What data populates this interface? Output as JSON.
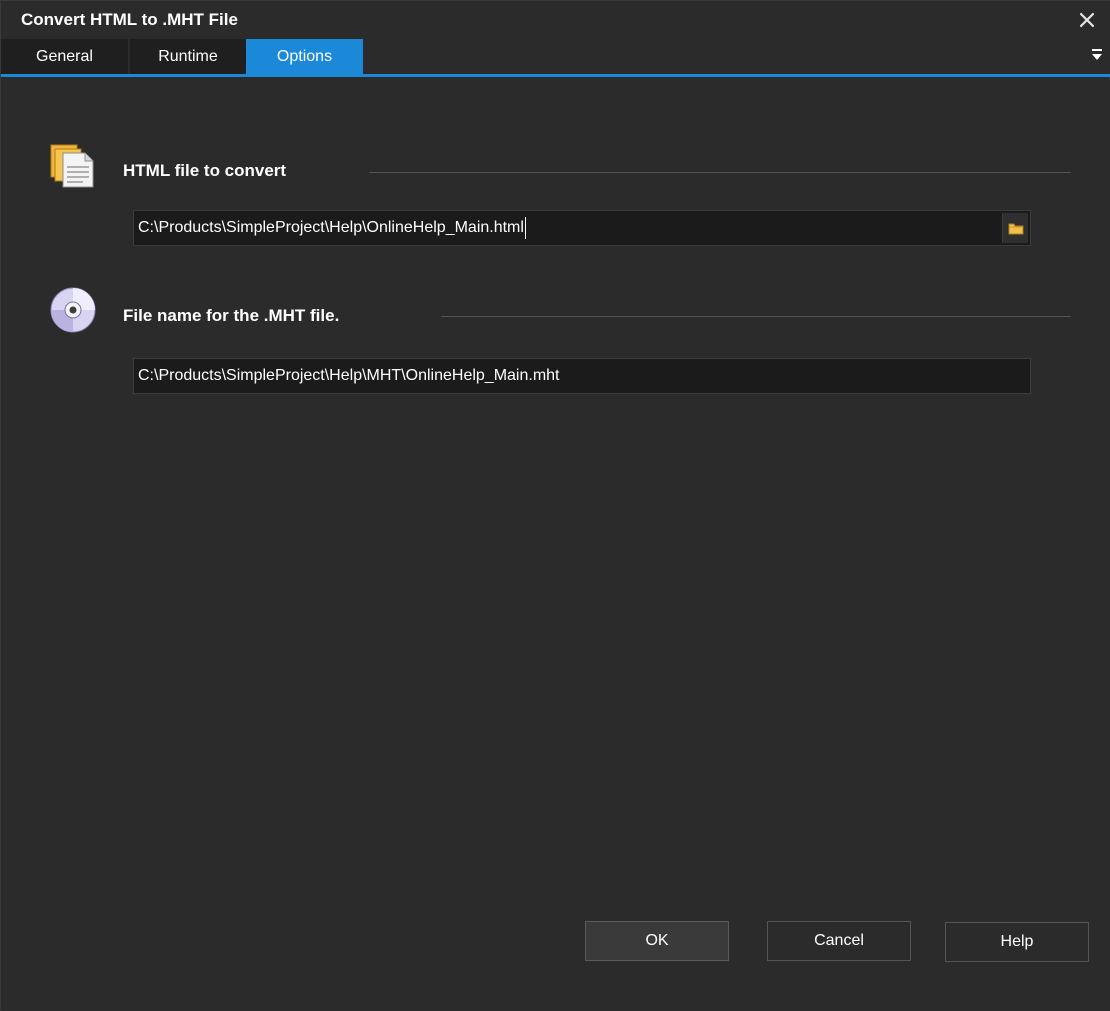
{
  "window": {
    "title": "Convert HTML to .MHT File",
    "close_icon": "close-icon"
  },
  "tabs": [
    {
      "label": "General",
      "active": false
    },
    {
      "label": "Runtime",
      "active": false
    },
    {
      "label": "Options",
      "active": true
    }
  ],
  "sections": {
    "html_file": {
      "label": "HTML file to convert",
      "icon": "documents-icon",
      "value": "C:\\Products\\SimpleProject\\Help\\OnlineHelp_Main.html",
      "browse_icon": "folder-icon"
    },
    "mht_file": {
      "label": "File name for the .MHT file.",
      "icon": "disc-icon",
      "value": "C:\\Products\\SimpleProject\\Help\\MHT\\OnlineHelp_Main.mht"
    }
  },
  "buttons": {
    "ok": "OK",
    "cancel": "Cancel",
    "help": "Help"
  },
  "colors": {
    "background": "#2b2b2b",
    "accent": "#1b88d8",
    "field_bg": "#1b1b1b"
  }
}
